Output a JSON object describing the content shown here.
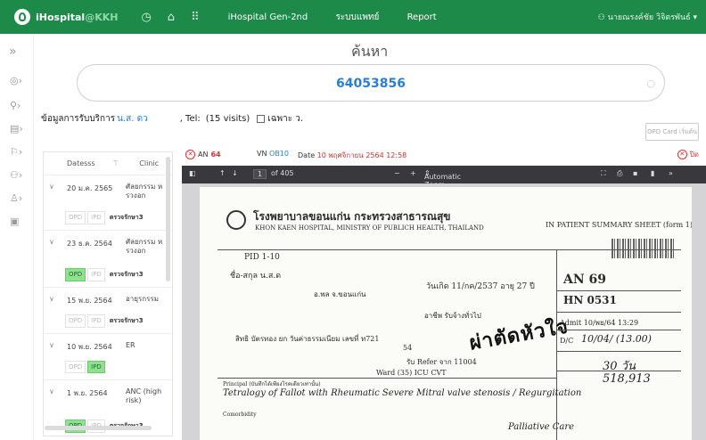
{
  "topbar": {
    "brand": "iHospital",
    "brand_suffix": "@KKH",
    "nav": [
      "iHospital Gen-2nd",
      "ระบบแพทย์",
      "Report"
    ],
    "user": "นายณรงค์ชัย วิจิตรพันธ์"
  },
  "search": {
    "title": "ค้นหา",
    "value": "64053856"
  },
  "patient_info": {
    "label": "ข้อมูลการรับบริการ",
    "name": "น.ส. ดว",
    "tel": ", Tel:",
    "visits": "(15 visits)",
    "only_label": "เฉพาะ ว.",
    "opd_card": "OPD Card เริ่มต้น"
  },
  "visits_table": {
    "headers": {
      "date": "Datesss",
      "clinic": "Clinic"
    },
    "rows": [
      {
        "date": "20 ม.ค. 2565",
        "clinic": "ศัลยกรรม หรวงอก",
        "tags": [
          "OPD",
          "IPD",
          "ตรวจรักษา3"
        ],
        "active": ""
      },
      {
        "date": "23 ธ.ค. 2564",
        "clinic": "ศัลยกรรม หรวงอก",
        "tags": [
          "OPD",
          "IPD",
          "ตรวจรักษา3"
        ],
        "active": "OPD"
      },
      {
        "date": "15 พ.ย. 2564",
        "clinic": "อายุรกรรม",
        "tags": [
          "OPD",
          "IPD",
          "ตรวจรักษา3"
        ],
        "active": ""
      },
      {
        "date": "10 พ.ย. 2564",
        "clinic": "ER",
        "tags": [
          "OPD",
          "IPD"
        ],
        "active": "IPD"
      },
      {
        "date": "1 พ.ย. 2564",
        "clinic": "ANC (high risk)",
        "tags": [
          "OPD",
          "IPD",
          "ตรวจรักษา3"
        ],
        "active": "OPD"
      }
    ]
  },
  "document": {
    "an_label": "AN",
    "an_value": "64",
    "vn_label": "VN",
    "vn_value": "OB10",
    "date_label": "Date",
    "date_value": "10 พฤศจิกายน 2564 12:58",
    "close_label": "ปิด"
  },
  "pdf_toolbar": {
    "page": "1",
    "of": "of 405",
    "zoom": "Automatic Zoom"
  },
  "scan": {
    "hospital_th": "โรงพยาบาลขอนแก่น กระทรวงสาธารณสุข",
    "hospital_en": "KHON KAEN HOSPITAL, MINISTRY OF PUBLICH HEALTH, THAILAND",
    "form_title": "IN PATIENT SUMMARY SHEET (form 1)",
    "pid": "PID  1-10",
    "name_line": "ชื่อ-สกุล  น.ส.ด",
    "address": "อ.พล จ.ขอนแก่น",
    "birth": "วันเกิด  11/กค/2537  อายุ 27 ปี",
    "an": "AN 69",
    "hn": "HN 0531",
    "admit": "Admit 10/พย/64 13:29",
    "dc": "D/C",
    "dc_hand": "10/04/ (13.00)",
    "los_hand": "30 วัน",
    "cost_hand": "518,913",
    "refer": "รับ Refer จาก 11004",
    "ward": "Ward (35) ICU CVT",
    "principal": "Principal (บันทึกได้เพียงโรคเดียวเท่านั้น)",
    "dx1": "Tetralogy of Fallot with Rheumatic  Severe Mitral valve stenosis / Regurgitation",
    "comorbid": "Comorbidity",
    "dx2": "Palliative Care",
    "stamp": "ผ่าตัดหัวใจ",
    "nationality": "อาชีพ รับจ้างทั่วไป",
    "right": "สิทธิ  บัตรทอง ยก วันค่าธรรมเนียม  เลขที่ ท721",
    "number54": "54"
  }
}
